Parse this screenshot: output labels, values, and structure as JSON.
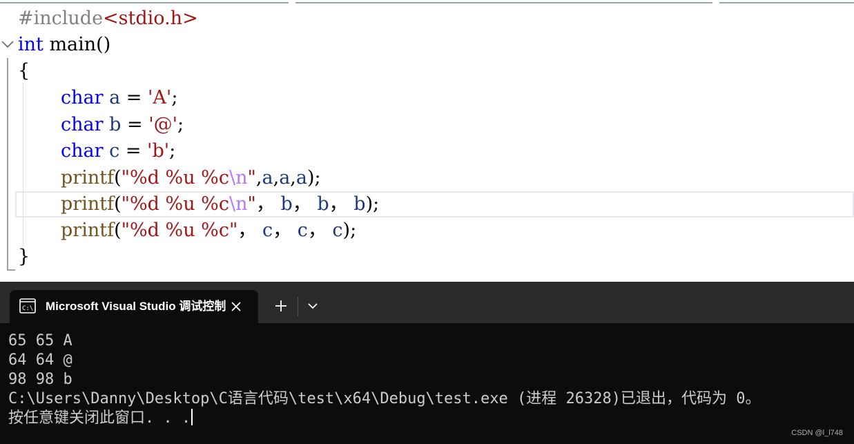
{
  "editor": {
    "lines": [
      {
        "tokens": [
          {
            "t": "#include",
            "c": "pp"
          },
          {
            "t": "<stdio.h>",
            "c": "inc"
          }
        ]
      },
      {
        "tokens": [
          {
            "t": "int",
            "c": "kw"
          },
          {
            "t": " main()",
            "c": "pun"
          }
        ]
      },
      {
        "tokens": [
          {
            "t": "{",
            "c": "pun"
          }
        ]
      },
      {
        "tokens": [
          {
            "t": "char",
            "c": "kw"
          },
          {
            "t": " a",
            "c": "var"
          },
          {
            "t": " = ",
            "c": "pun"
          },
          {
            "t": "'A'",
            "c": "str"
          },
          {
            "t": ";",
            "c": "pun"
          }
        ]
      },
      {
        "tokens": [
          {
            "t": "char",
            "c": "kw"
          },
          {
            "t": " b",
            "c": "var"
          },
          {
            "t": " = ",
            "c": "pun"
          },
          {
            "t": "'@'",
            "c": "str"
          },
          {
            "t": ";",
            "c": "pun"
          }
        ]
      },
      {
        "tokens": [
          {
            "t": "char",
            "c": "kw"
          },
          {
            "t": " c",
            "c": "var"
          },
          {
            "t": " = ",
            "c": "pun"
          },
          {
            "t": "'b'",
            "c": "str"
          },
          {
            "t": ";",
            "c": "pun"
          }
        ]
      },
      {
        "tokens": [
          {
            "t": "printf",
            "c": "fn"
          },
          {
            "t": "(",
            "c": "pun"
          },
          {
            "t": "\"%d %u %c",
            "c": "str"
          },
          {
            "t": "\\n",
            "c": "esc"
          },
          {
            "t": "\"",
            "c": "str"
          },
          {
            "t": ",",
            "c": "pun"
          },
          {
            "t": "a",
            "c": "var"
          },
          {
            "t": ",",
            "c": "pun"
          },
          {
            "t": "a",
            "c": "var"
          },
          {
            "t": ",",
            "c": "pun"
          },
          {
            "t": "a",
            "c": "var"
          },
          {
            "t": ");",
            "c": "pun"
          }
        ]
      },
      {
        "tokens": [
          {
            "t": "printf",
            "c": "fn"
          },
          {
            "t": "(",
            "c": "pun"
          },
          {
            "t": "\"%d %u %c",
            "c": "str"
          },
          {
            "t": "\\n",
            "c": "esc"
          },
          {
            "t": "\"",
            "c": "str"
          },
          {
            "t": "， ",
            "c": "pun"
          },
          {
            "t": "b",
            "c": "var"
          },
          {
            "t": "， ",
            "c": "pun"
          },
          {
            "t": "b",
            "c": "var"
          },
          {
            "t": "， ",
            "c": "pun"
          },
          {
            "t": "b",
            "c": "var"
          },
          {
            "t": ");",
            "c": "pun"
          }
        ]
      },
      {
        "tokens": [
          {
            "t": "printf",
            "c": "fn"
          },
          {
            "t": "(",
            "c": "pun"
          },
          {
            "t": "\"%d %u %c\"",
            "c": "str"
          },
          {
            "t": "， ",
            "c": "pun"
          },
          {
            "t": "c",
            "c": "var"
          },
          {
            "t": "， ",
            "c": "pun"
          },
          {
            "t": "c",
            "c": "var"
          },
          {
            "t": "， ",
            "c": "pun"
          },
          {
            "t": "c",
            "c": "var"
          },
          {
            "t": ");",
            "c": "pun"
          }
        ]
      },
      {
        "tokens": [
          {
            "t": "}",
            "c": "pun"
          }
        ]
      }
    ]
  },
  "terminal": {
    "tab_title": "Microsoft Visual Studio 调试控制台",
    "tab_icon": "terminal-icon",
    "close_icon": "close-icon",
    "new_tab_icon": "plus-icon",
    "dropdown_icon": "chevron-down-icon",
    "output": [
      "65 65 A",
      "64 64 @",
      "98 98 b",
      "C:\\Users\\Danny\\Desktop\\C语言代码\\test\\x64\\Debug\\test.exe (进程 26328)已退出，代码为 0。",
      "按任意键关闭此窗口. . ."
    ]
  },
  "watermark": "CSDN @l_l748",
  "colors": {
    "keyword": "#0000ff",
    "string": "#a31515",
    "escape": "#b776fb",
    "function": "#74531f",
    "variable": "#1f377f",
    "preprocessor": "#808080",
    "terminal_bg": "#0c0c0c",
    "tab_bar_bg": "#2b2b2b"
  }
}
